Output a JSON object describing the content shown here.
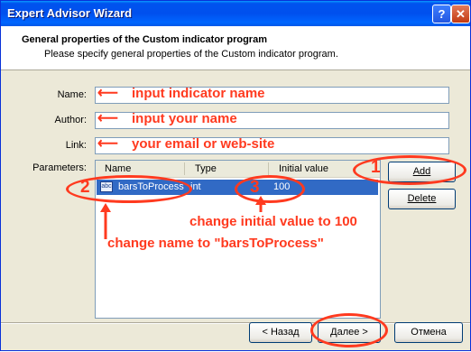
{
  "window": {
    "title": "Expert Advisor Wizard",
    "help_btn": "?",
    "close_btn": "✕"
  },
  "header": {
    "title": "General properties of the Custom indicator program",
    "subtitle": "Please specify general properties of the Custom indicator program."
  },
  "form": {
    "name_label": "Name:",
    "author_label": "Author:",
    "link_label": "Link:",
    "parameters_label": "Parameters:",
    "name_value": "",
    "author_value": "",
    "link_value": ""
  },
  "parameters": {
    "columns": [
      "Name",
      "Type",
      "Initial value"
    ],
    "rows": [
      {
        "name": "barsToProcess",
        "type": "int",
        "initial_value": "100"
      }
    ]
  },
  "buttons": {
    "add": "Add",
    "delete": "Delete",
    "back": "< Назад",
    "next": "Далее >",
    "cancel": "Отмена"
  },
  "annotations": {
    "name_hint": "input indicator name",
    "author_hint": "input your name",
    "link_hint": "your email or web-site",
    "value_hint": "change initial value to 100",
    "rename_hint": "change name to \"barsToProcess\"",
    "step1": "1",
    "step2": "2",
    "step3": "3",
    "arrow": "⟵",
    "color": "#ff3a1f"
  }
}
